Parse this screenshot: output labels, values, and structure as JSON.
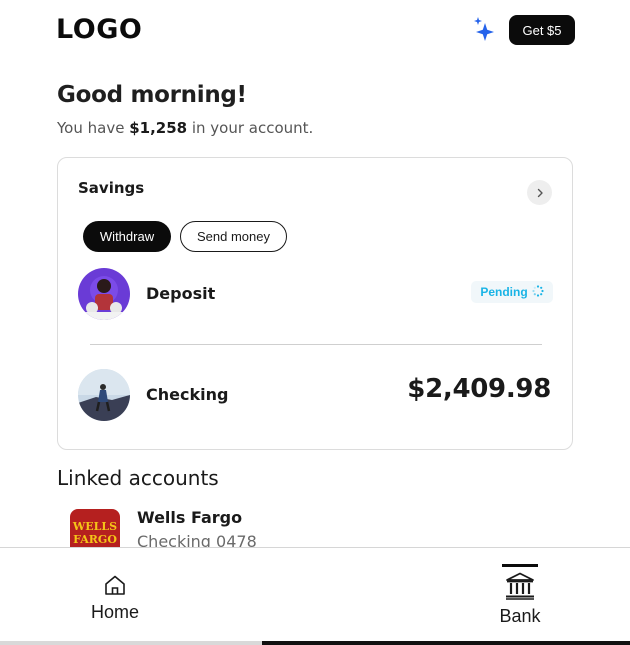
{
  "header": {
    "logo": "LOGO",
    "promo_button": "Get $5"
  },
  "greeting": {
    "title": "Good morning!",
    "prefix": "You have ",
    "amount": "$1,258",
    "suffix": " in your account."
  },
  "savings_card": {
    "title": "Savings",
    "actions": {
      "withdraw": "Withdraw",
      "send_money": "Send money"
    },
    "rows": [
      {
        "label": "Deposit",
        "status": "Pending"
      },
      {
        "label": "Checking",
        "amount": "$2,409.98"
      }
    ]
  },
  "linked_accounts": {
    "title": "Linked accounts",
    "items": [
      {
        "logo_line1": "WELLS",
        "logo_line2": "FARGO",
        "name": "Wells Fargo",
        "detail": "Checking 0478"
      }
    ]
  },
  "bottom_nav": {
    "items": [
      {
        "label": "Home",
        "icon": "home-icon"
      },
      {
        "label": "Bank",
        "icon": "bank-icon",
        "active": true
      }
    ]
  },
  "colors": {
    "accent": "#0b0b0b",
    "pending": "#1ab4e6",
    "sparkle": "#2563eb",
    "bank_brand": "#b5201f",
    "bank_brand_text": "#f5c518"
  }
}
